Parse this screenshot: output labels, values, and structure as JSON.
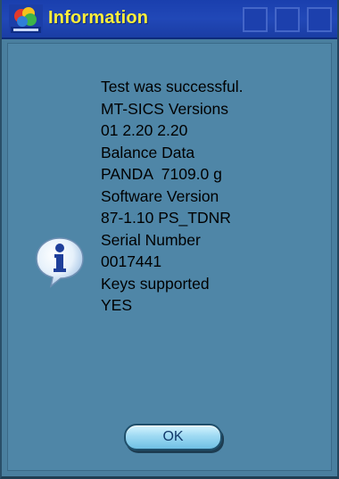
{
  "window": {
    "title": "Information"
  },
  "message": {
    "lines": [
      "Test was successful.",
      "MT-SICS Versions",
      "01 2.20 2.20",
      "Balance Data",
      "PANDA  7109.0 g",
      "Software Version",
      "87-1.10 PS_TDNR",
      "Serial Number",
      "0017441",
      "Keys supported",
      "YES"
    ]
  },
  "buttons": {
    "ok_label": "OK"
  },
  "icons": {
    "app_logo": "app-logo-icon",
    "info": "info-icon"
  },
  "colors": {
    "title_text": "#ffef3a",
    "titlebar": "#1a3fae",
    "background": "#4f86a7",
    "button": "#9fdaf3"
  }
}
